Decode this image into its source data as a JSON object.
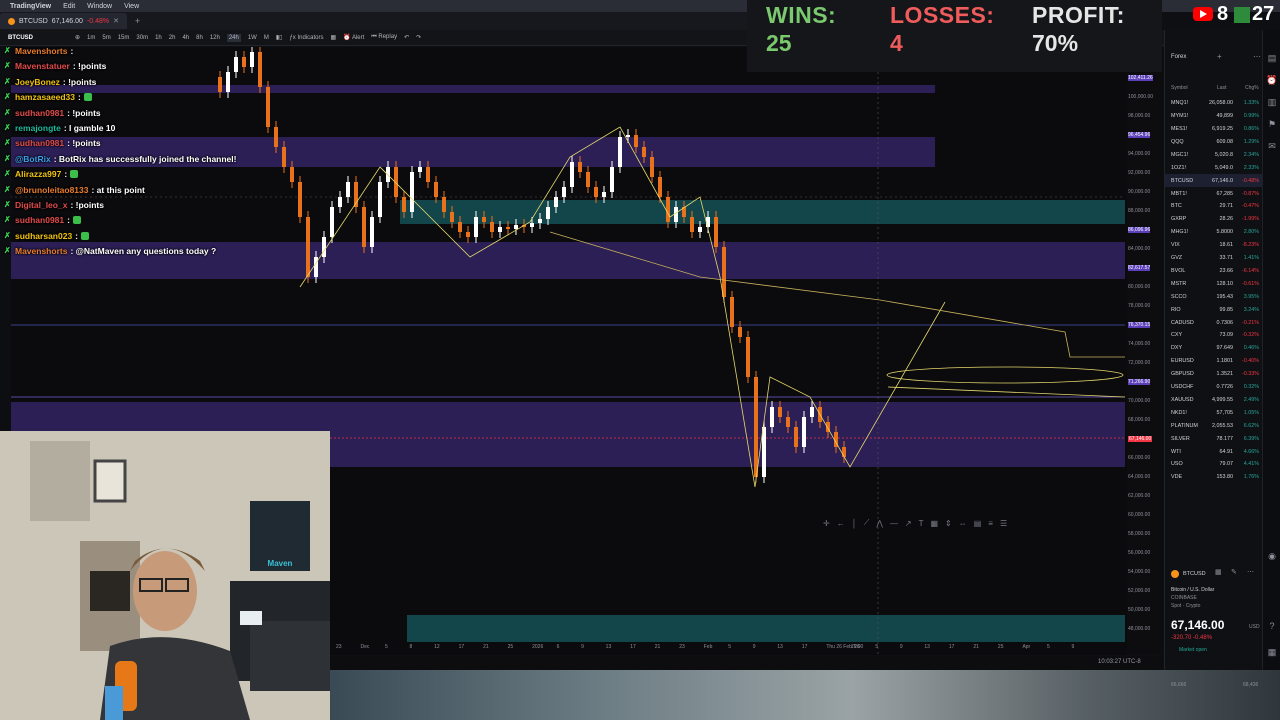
{
  "menubar": {
    "app": "TradingView",
    "items": [
      "Edit",
      "Window",
      "View"
    ]
  },
  "tab": {
    "label": "BTCUSD",
    "price": "67,146.00",
    "change": "-0.48%"
  },
  "toolbar": {
    "symbol": "BTCUSD",
    "timeframes": [
      "1m",
      "5m",
      "15m",
      "30m",
      "1h",
      "2h",
      "4h",
      "8h",
      "12h",
      "24h",
      "1W",
      "M"
    ],
    "indicators": "Indicators",
    "alert": "Alert",
    "replay": "Replay"
  },
  "scoreboard": {
    "wins_label": "WINS:",
    "wins": "25",
    "losses_label": "LOSSES:",
    "losses": "4",
    "profit_label": "PROFIT:",
    "profit": "70%"
  },
  "youtube": {
    "count": "8",
    "overlay": "27"
  },
  "chat": [
    {
      "user": "Mavenshorts",
      "text": ": ",
      "user_color": "#e87d2d"
    },
    {
      "user": "Mavenstatuer",
      "text": ": !points",
      "user_color": "#e24b4b"
    },
    {
      "user": "JoeyBonez",
      "text": ": !points",
      "user_color": "#f1c40f"
    },
    {
      "user": "hamzasaeed33",
      "text": ": ",
      "user_color": "#f1c40f",
      "badge": true
    },
    {
      "user": "sudhan0981",
      "text": ": !points",
      "user_color": "#e24b4b"
    },
    {
      "user": "remajongte",
      "text": ": I gamble 10",
      "user_color": "#1abc9c"
    },
    {
      "user": "sudhan0981",
      "text": ": !points",
      "user_color": "#e24b4b"
    },
    {
      "user": "@BotRix",
      "text": ": BotRix has successfully joined the channel!",
      "user_color": "#3aa0e8"
    },
    {
      "user": "Alirazza997",
      "text": ": ",
      "user_color": "#f1c40f",
      "badge": true
    },
    {
      "user": "@brunoleitao8133",
      "text": ": at this point",
      "user_color": "#e87d2d"
    },
    {
      "user": "Digital_leo_x",
      "text": ": !points",
      "user_color": "#e24b4b"
    },
    {
      "user": "sudhan0981",
      "text": ": ",
      "user_color": "#e24b4b",
      "badge": true
    },
    {
      "user": "sudharsan023",
      "text": ": ",
      "user_color": "#f1c40f",
      "badge": true
    },
    {
      "user": "Mavenshorts",
      "text": ": @NatMaven any questions today ?",
      "user_color": "#e87d2d"
    }
  ],
  "price_axis": [
    "102,411.26",
    "100,000.00",
    "98,000.00",
    "96,454.96",
    "94,000.00",
    "92,000.00",
    "90,000.00",
    "88,000.00",
    "86,096.96",
    "84,000.00",
    "82,617.57",
    "80,000.00",
    "78,000.00",
    "76,370.15",
    "74,000.00",
    "72,000.00",
    "71,266.90",
    "70,000.00",
    "68,000.00",
    "67,146.00",
    "66,000.00",
    "64,000.00",
    "62,000.00",
    "60,000.00",
    "58,000.00",
    "56,000.00",
    "54,000.00",
    "52,000.00",
    "50,000.00",
    "48,000.00"
  ],
  "time_axis": [
    "23",
    "Dec",
    "5",
    "8",
    "12",
    "17",
    "21",
    "25",
    "2026",
    "6",
    "9",
    "13",
    "17",
    "21",
    "23",
    "Feb",
    "5",
    "9",
    "13",
    "17",
    "Thu 26 Feb '26",
    "16:00",
    "5",
    "9",
    "13",
    "17",
    "21",
    "25",
    "Apr",
    "5",
    "9"
  ],
  "status": {
    "clock": "10:03:27 UTC-8"
  },
  "watchlist": {
    "header": "Forex",
    "cols": [
      "Symbol",
      "Last",
      "Chg%"
    ],
    "rows": [
      {
        "sym": "MNQ1!",
        "last": "26,058.00",
        "chg": "1.33%",
        "up": true
      },
      {
        "sym": "MYM1!",
        "last": "49,899",
        "chg": "0.99%",
        "up": true
      },
      {
        "sym": "MES1!",
        "last": "6,919.25",
        "chg": "0.86%",
        "up": true
      },
      {
        "sym": "QQQ",
        "last": "609.08",
        "chg": "1.29%",
        "up": true
      },
      {
        "sym": "MGC1!",
        "last": "5,020.8",
        "chg": "2.34%",
        "up": true
      },
      {
        "sym": "1OZ1!",
        "last": "5,049.0",
        "chg": "2.33%",
        "up": true
      },
      {
        "sym": "BTCUSD",
        "last": "67,146.0",
        "chg": "-0.48%",
        "up": false
      },
      {
        "sym": "MBT1!",
        "last": "67,285",
        "chg": "-0.87%",
        "up": false
      },
      {
        "sym": "BTC",
        "last": "29.71",
        "chg": "-0.47%",
        "up": false
      },
      {
        "sym": "GXRP",
        "last": "28.26",
        "chg": "-1.99%",
        "up": false
      },
      {
        "sym": "MHG1!",
        "last": "5.8000",
        "chg": "2.80%",
        "up": true
      },
      {
        "sym": "VIX",
        "last": "18.61",
        "chg": "-8.23%",
        "up": false
      },
      {
        "sym": "GVZ",
        "last": "33.71",
        "chg": "1.41%",
        "up": true
      },
      {
        "sym": "BVOL",
        "last": "23.66",
        "chg": "-6.14%",
        "up": false
      },
      {
        "sym": "MSTR",
        "last": "128.10",
        "chg": "-0.61%",
        "up": false
      },
      {
        "sym": "SCCO",
        "last": "195.43",
        "chg": "3.95%",
        "up": true
      },
      {
        "sym": "RIO",
        "last": "99.85",
        "chg": "3.24%",
        "up": true
      },
      {
        "sym": "CADUSD",
        "last": "0.7306",
        "chg": "-0.21%",
        "up": false
      },
      {
        "sym": "CXY",
        "last": "73.09",
        "chg": "-0.32%",
        "up": false
      },
      {
        "sym": "DXY",
        "last": "97.649",
        "chg": "0.46%",
        "up": true
      },
      {
        "sym": "EURUSD",
        "last": "1.1801",
        "chg": "-0.40%",
        "up": false
      },
      {
        "sym": "GBPUSD",
        "last": "1.3521",
        "chg": "-0.33%",
        "up": false
      },
      {
        "sym": "USDCHF",
        "last": "0.7726",
        "chg": "0.32%",
        "up": true
      },
      {
        "sym": "XAUUSD",
        "last": "4,999.55",
        "chg": "2.49%",
        "up": true
      },
      {
        "sym": "NKD1!",
        "last": "57,705",
        "chg": "1.05%",
        "up": true
      },
      {
        "sym": "PLATINUM",
        "last": "2,055.53",
        "chg": "6.62%",
        "up": true
      },
      {
        "sym": "SILVER",
        "last": "78.177",
        "chg": "6.39%",
        "up": true
      },
      {
        "sym": "WTI",
        "last": "64.91",
        "chg": "4.66%",
        "up": true
      },
      {
        "sym": "USO",
        "last": "79.07",
        "chg": "4.41%",
        "up": true
      },
      {
        "sym": "VDE",
        "last": "153.80",
        "chg": "1.76%",
        "up": true
      }
    ]
  },
  "detail": {
    "sym": "BTCUSD",
    "name": "Bitcoin / U.S. Dollar",
    "exchange": "COINBASE",
    "type": "Spot · Crypto",
    "price": "67,146.00",
    "currency": "USD",
    "change": "-320.70 -0.48%",
    "status": "Market open",
    "footer_left": "66,666",
    "footer_right": "68,436"
  },
  "webcam": {
    "sign": "Maven"
  },
  "colors": {
    "up": "#26a69a",
    "down": "#f23645",
    "wins": "#7bc96f",
    "losses": "#f05b5b",
    "profit": "#e6e6e6",
    "zone_purple": "#2b1f55",
    "zone_teal": "#13464a",
    "accent": "#2962ff"
  }
}
